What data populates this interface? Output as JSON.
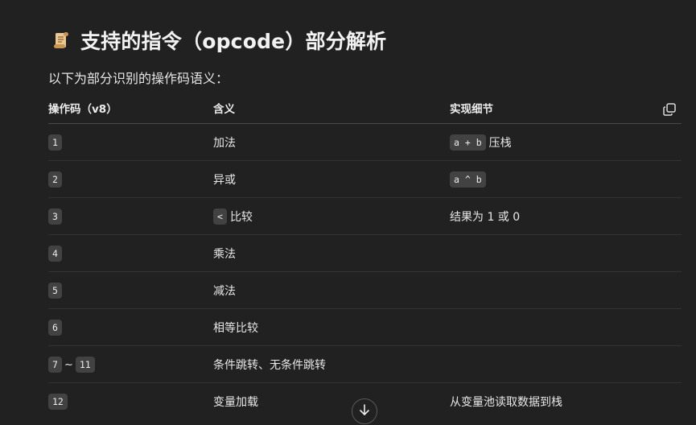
{
  "heading": {
    "icon": "scroll-icon",
    "title": "支持的指令（opcode）部分解析"
  },
  "intro": "以下为部分识别的操作码语义：",
  "table": {
    "headers": [
      "操作码（v8）",
      "含义",
      "实现细节"
    ],
    "copy_icon": "copy-icon",
    "rows": [
      {
        "op1": "1",
        "meaning": "加法",
        "detail_code": "a + b",
        "detail_text": "压栈"
      },
      {
        "op1": "2",
        "meaning": "异或",
        "detail_code": "a ^ b",
        "detail_text": ""
      },
      {
        "op1": "3",
        "meaning_code": "<",
        "meaning": "比较",
        "detail_text": "结果为 1 或 0"
      },
      {
        "op1": "4",
        "meaning": "乘法",
        "detail_text": ""
      },
      {
        "op1": "5",
        "meaning": "减法",
        "detail_text": ""
      },
      {
        "op1": "6",
        "meaning": "相等比较",
        "detail_text": ""
      },
      {
        "op1": "7",
        "sep": "~",
        "op2": "11",
        "meaning": "条件跳转、无条件跳转",
        "detail_text": ""
      },
      {
        "op1": "12",
        "meaning": "变量加载",
        "detail_text": "从变量池读取数据到栈"
      }
    ]
  },
  "scroll_down_icon": "arrow-down-icon"
}
